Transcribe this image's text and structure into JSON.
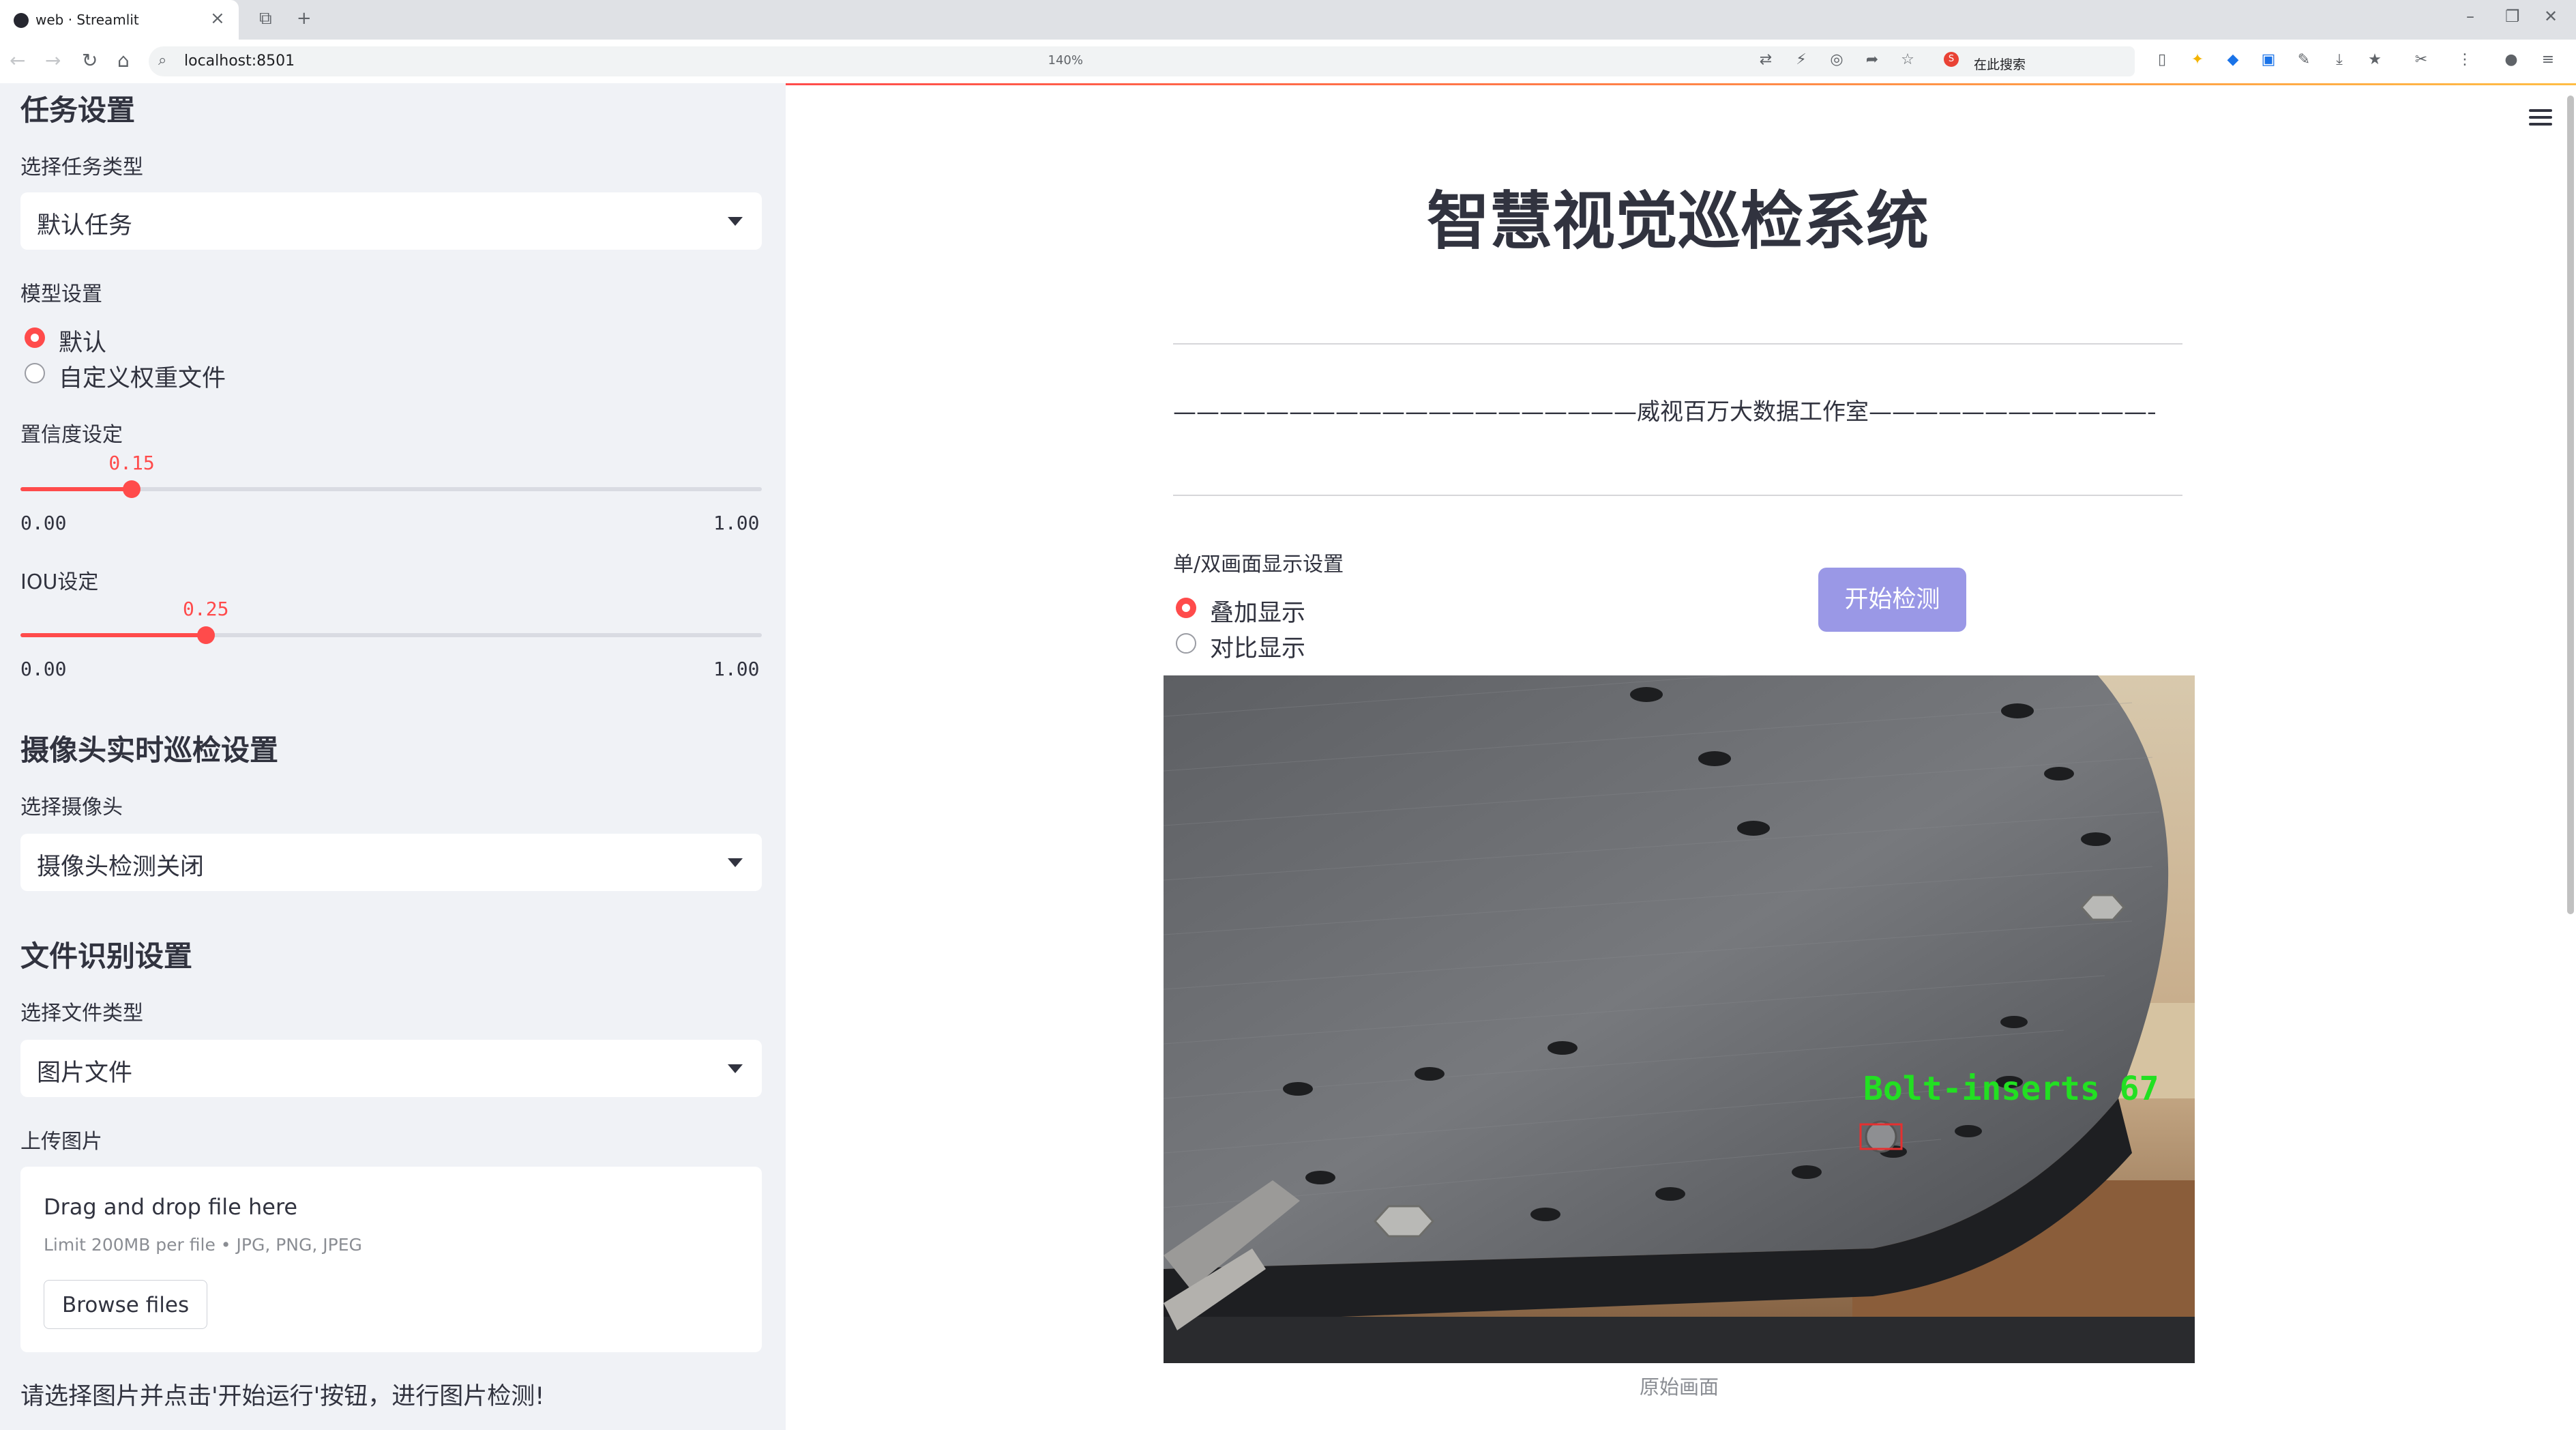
{
  "browser": {
    "tab_title": "web · Streamlit",
    "url": "localhost:8501",
    "zoom": "140%",
    "search_placeholder": "在此搜索",
    "tab_close": "×",
    "new_tab": "+",
    "tab_search_icon": "⧉",
    "window_min": "–",
    "window_restore": "❐",
    "window_close": "✕",
    "nav_back": "←",
    "nav_forward": "→",
    "nav_reload": "↻",
    "nav_home": "⌂",
    "search_engine_badge": "S"
  },
  "sidebar": {
    "task_heading": "任务设置",
    "task_type_label": "选择任务类型",
    "task_type_value": "默认任务",
    "model_label": "模型设置",
    "model_options": [
      "默认",
      "自定义权重文件"
    ],
    "model_selected": "默认",
    "conf_label": "置信度设定",
    "conf_value": 0.15,
    "conf_value_text": "0.15",
    "conf_min": "0.00",
    "conf_max": "1.00",
    "iou_label": "IOU设定",
    "iou_value": 0.25,
    "iou_value_text": "0.25",
    "iou_min": "0.00",
    "iou_max": "1.00",
    "camera_heading": "摄像头实时巡检设置",
    "camera_label": "选择摄像头",
    "camera_value": "摄像头检测关闭",
    "file_heading": "文件识别设置",
    "file_type_label": "选择文件类型",
    "file_type_value": "图片文件",
    "upload_label": "上传图片",
    "upload_drop": "Drag and drop file here",
    "upload_limit": "Limit 200MB per file • JPG, PNG, JPEG",
    "upload_button": "Browse files",
    "note": "请选择图片并点击'开始运行'按钮，进行图片检测!"
  },
  "main": {
    "title": "智慧视觉巡检系统",
    "studio_line": "————————————————————威视百万大数据工作室—————————————————————",
    "display_label": "单/双画面显示设置",
    "display_options": [
      "叠加显示",
      "对比显示"
    ],
    "display_selected": "叠加显示",
    "start_button": "开始检测",
    "detection_label": "Bolt-inserts 67",
    "detection_color": "#22e022",
    "image_caption": "原始画面"
  },
  "colors": {
    "accent": "#ff4b4b",
    "button": "#9a98e6",
    "sidebar_bg": "#f0f2f6"
  }
}
